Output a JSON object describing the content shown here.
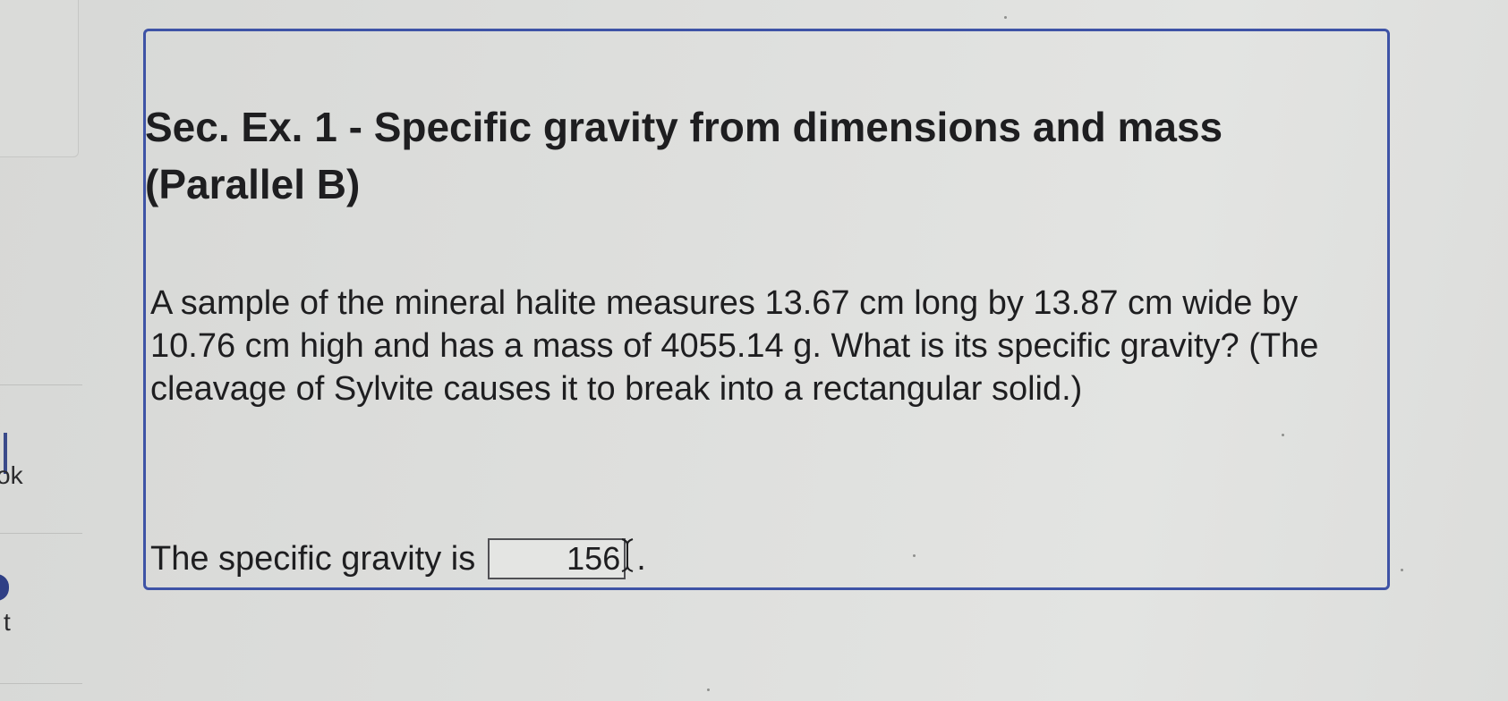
{
  "question": {
    "title": "Sec. Ex. 1 - Specific gravity from dimensions and mass (Parallel B)",
    "body": "A sample of the mineral halite measures 13.67 cm long by 13.87 cm wide by 10.76 cm high and has a mass of 4055.14 g. What is its specific gravity? (The cleavage of Sylvite causes it to break into a rectangular solid.)",
    "answer_label": "The specific gravity is",
    "answer_value": "156",
    "answer_suffix": "."
  },
  "left_panel": {
    "fragment_1": "ok",
    "fragment_2": "t"
  },
  "colors": {
    "card_border": "#3e53a6",
    "text": "#1e1e20",
    "background": "#dedfdd"
  },
  "icons": {
    "cursor": "text-cursor-icon"
  }
}
